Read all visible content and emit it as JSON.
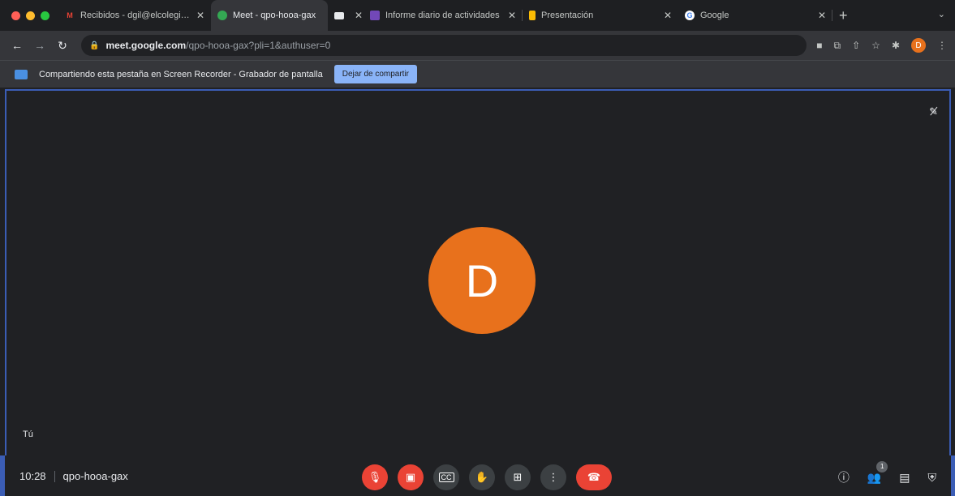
{
  "window": {
    "traffic_colors": [
      "#ff5f57",
      "#febc2e",
      "#28c840"
    ]
  },
  "tabs": [
    {
      "title": "Recibidos - dgil@elcolegiodeh",
      "icon": "gmail-icon",
      "color": "#ea4335",
      "active": false
    },
    {
      "title": "Meet - qpo-hooa-gax",
      "icon": "meet-icon",
      "color": "#34a853",
      "active": true
    },
    {
      "title": "",
      "icon": "screen-icon",
      "color": "#e8eaed",
      "active": false
    },
    {
      "title": "Informe diario de actividades",
      "icon": "forms-icon",
      "color": "#7248b9",
      "active": false
    },
    {
      "title": "Presentación",
      "icon": "slides-icon",
      "color": "#fbbc04",
      "active": false
    },
    {
      "title": "Google",
      "icon": "google-icon",
      "color": "#ffffff",
      "active": false
    }
  ],
  "address": {
    "host": "meet.google.com",
    "path": "/qpo-hooa-gax?pli=1&authuser=0"
  },
  "profile_initial": "D",
  "infobar": {
    "message": "Compartiendo esta pestaña en Screen Recorder - Grabador de pantalla",
    "stop_label": "Dejar de compartir"
  },
  "meet": {
    "avatar_initial": "D",
    "avatar_color": "#e8711c",
    "self_label": "Tú",
    "time": "10:28",
    "meeting_code": "qpo-hooa-gax",
    "participant_count": "1"
  }
}
